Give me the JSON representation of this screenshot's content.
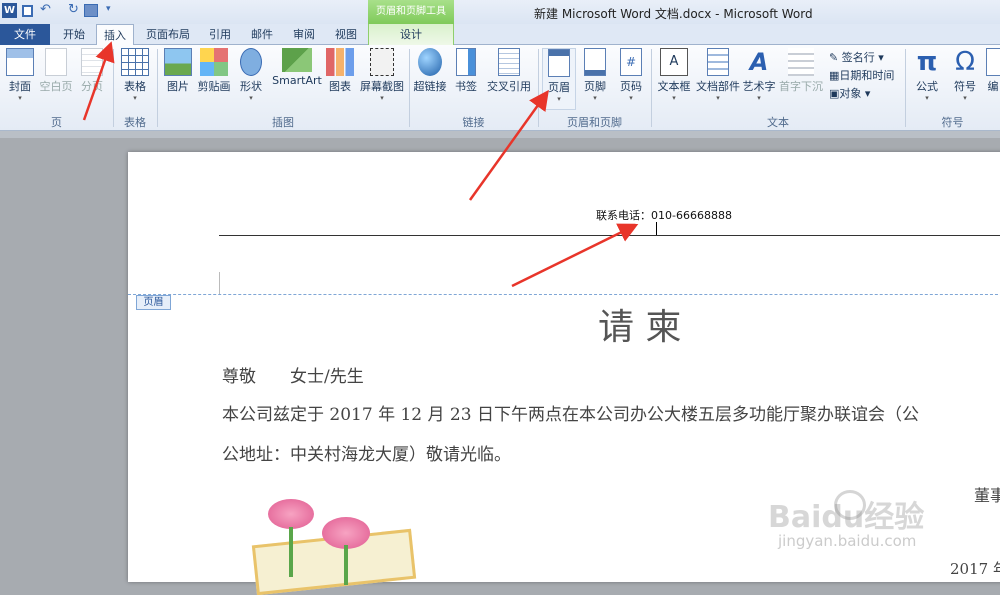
{
  "window": {
    "title": "新建 Microsoft Word 文档.docx - Microsoft Word",
    "context_tab_group": "页眉和页脚工具"
  },
  "tabs": [
    {
      "label": "文件"
    },
    {
      "label": "开始"
    },
    {
      "label": "插入"
    },
    {
      "label": "页面布局"
    },
    {
      "label": "引用"
    },
    {
      "label": "邮件"
    },
    {
      "label": "审阅"
    },
    {
      "label": "视图"
    },
    {
      "label": "设计"
    }
  ],
  "ribbon": {
    "buttons": {
      "cover": "封面",
      "blank": "空白页",
      "break": "分页",
      "table": "表格",
      "picture": "图片",
      "clipart": "剪贴画",
      "shapes": "形状",
      "smartart": "SmartArt",
      "chart": "图表",
      "screenshot": "屏幕截图",
      "hyperlink": "超链接",
      "bookmark": "书签",
      "crossref": "交叉引用",
      "header": "页眉",
      "footer": "页脚",
      "pagenum": "页码",
      "textbox": "文本框",
      "quickparts": "文档部件",
      "wordart": "艺术字",
      "dropcap": "首字下沉",
      "equation": "公式",
      "symbol": "符号",
      "number": "编"
    },
    "small": {
      "signature": "签名行",
      "datetime": "日期和时间",
      "object": "对象"
    },
    "groups": {
      "pages": "页",
      "tables": "表格",
      "illustrations": "插图",
      "links": "链接",
      "headerfooter": "页眉和页脚",
      "text": "文本",
      "symbols": "符号"
    }
  },
  "document": {
    "header_text": "联系电话：010-66668888",
    "header_tag": "页眉",
    "title": "请 柬",
    "salutation": "尊敬　　女士/先生",
    "body_line1": "本公司兹定于 2017 年 12 月 23 日下午两点在本公司办公大楼五层多功能厅聚办联谊会（公",
    "body_line2": "公地址：中关村海龙大厦）敬请光临。",
    "signer": "董事",
    "date": "2017 年"
  },
  "watermark": {
    "brand": "Baidu经验",
    "url": "jingyan.baidu.com"
  },
  "colors": {
    "file_tab": "#2b579a",
    "arrow": "#e8352a",
    "context": "#7fca5a"
  }
}
